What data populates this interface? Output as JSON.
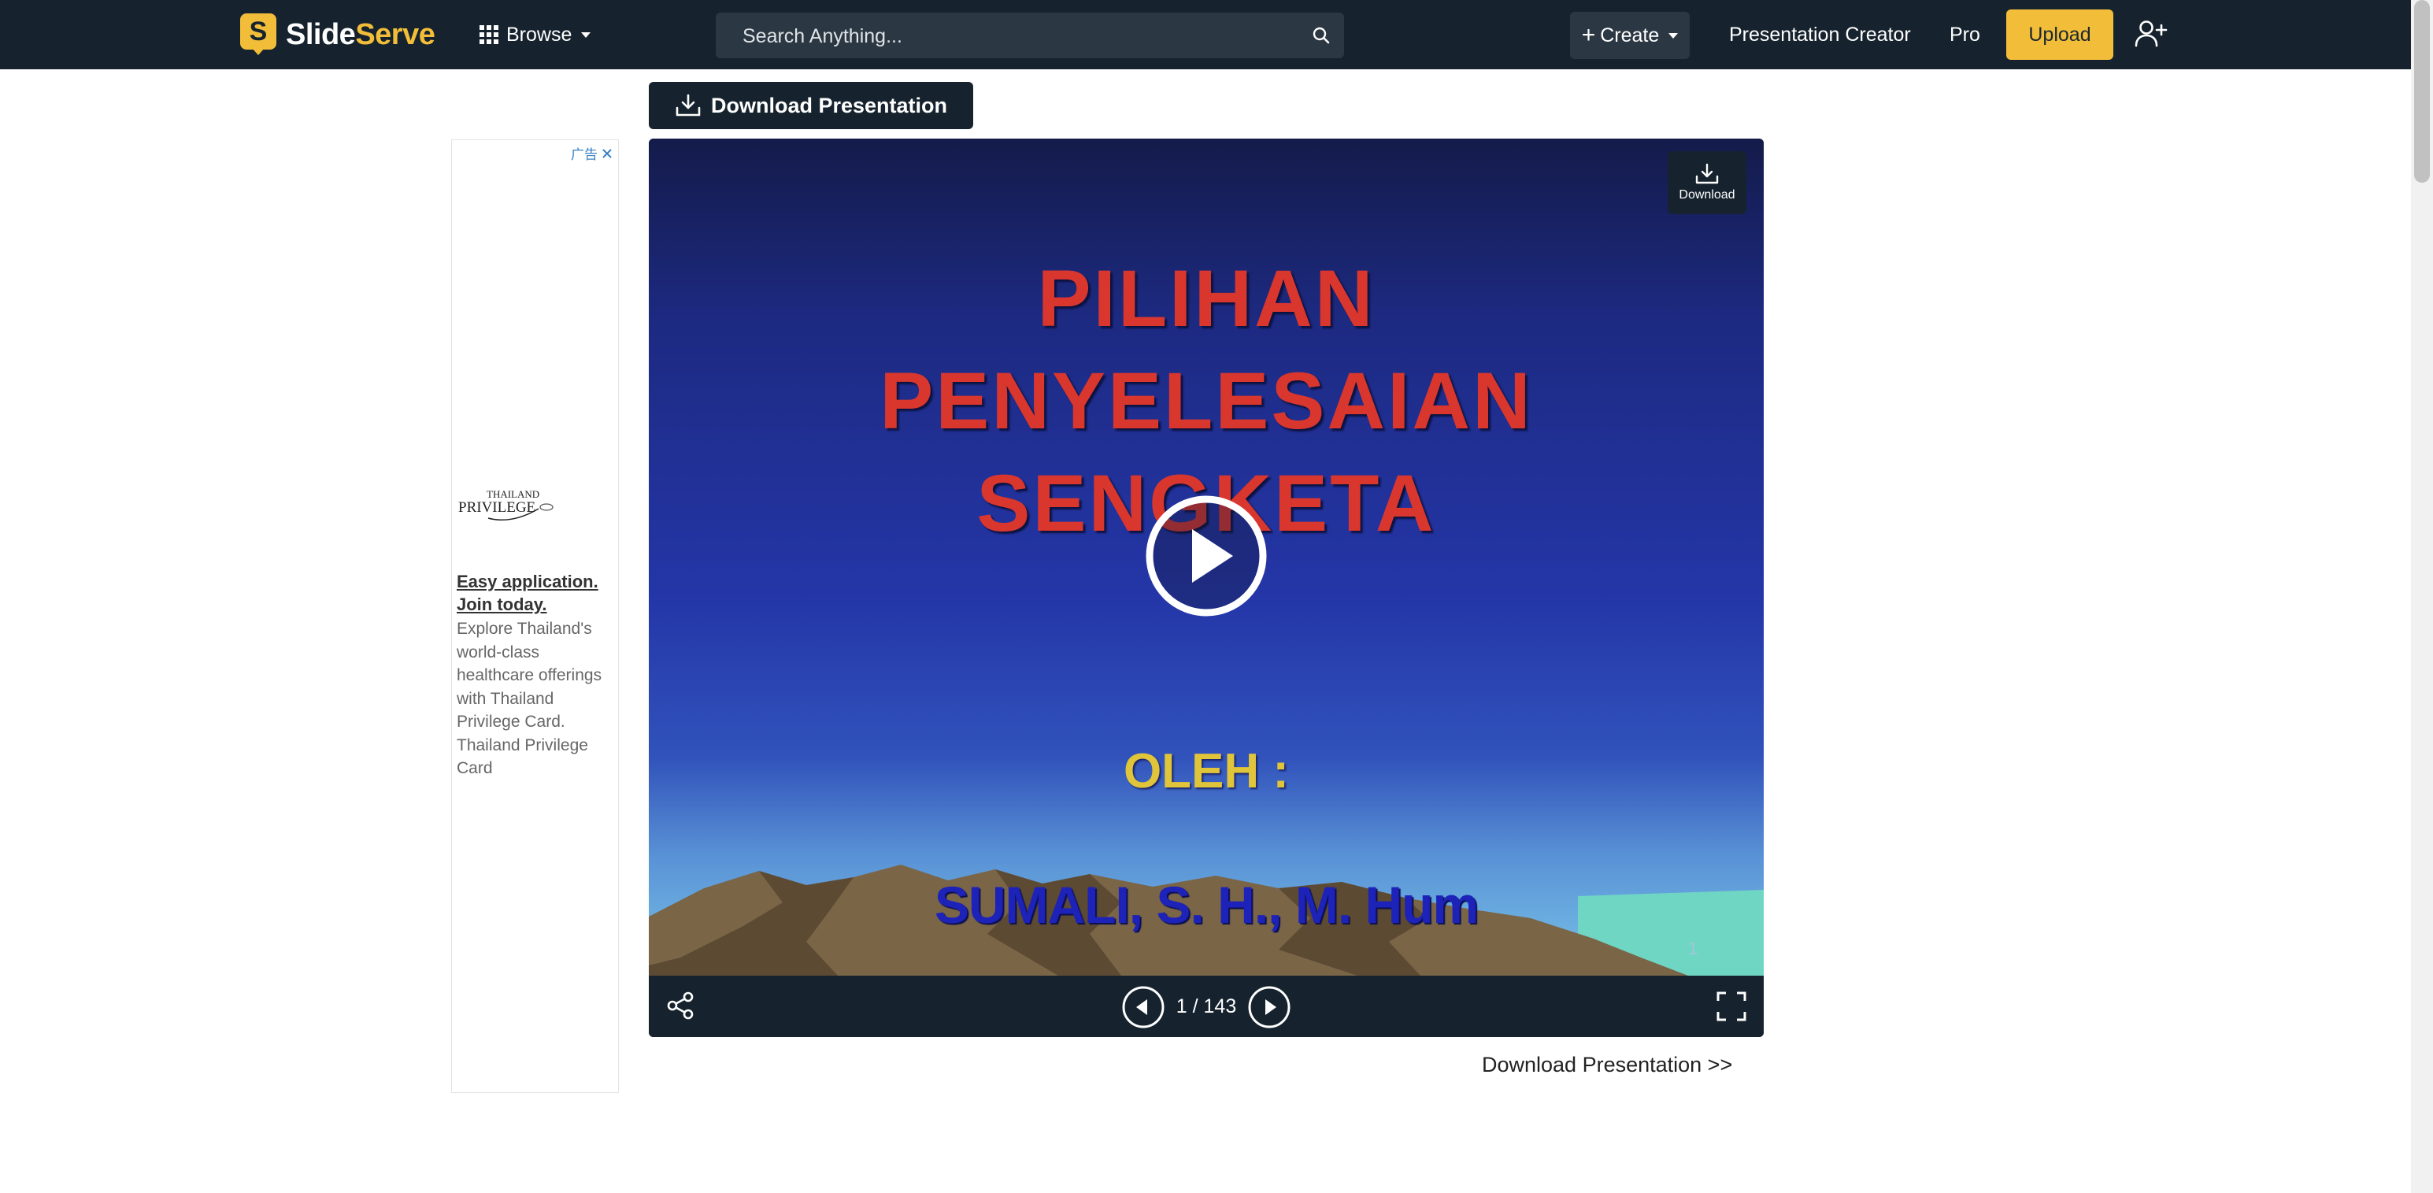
{
  "brand": {
    "name_part1": "Slide",
    "name_part2": "Serve",
    "mark_letter": "S"
  },
  "nav": {
    "browse_label": "Browse",
    "search_placeholder": "Search Anything...",
    "create_label": "Create",
    "presentation_creator_label": "Presentation Creator",
    "pro_label": "Pro",
    "upload_label": "Upload"
  },
  "toolbar": {
    "download_presentation_label": "Download Presentation"
  },
  "ad": {
    "badge_text": "广告",
    "logo_text_top": "THAILAND",
    "logo_text_bottom": "PRIVILEGE",
    "title": "Easy application. Join today.",
    "body": "Explore Thailand's world-class healthcare offerings with Thailand Privilege Card. Thailand Privilege Card"
  },
  "slide": {
    "title_line1": "PILIHAN",
    "title_line2": "PENYELESAIAN",
    "title_line3": "SENGKETA",
    "by_label": "OLEH :",
    "author": "SUMALI, S. H., M. Hum",
    "slide_number": "1",
    "corner_download_label": "Download"
  },
  "viewer": {
    "counter": "1 / 143"
  },
  "footer": {
    "download_link": "Download Presentation >>"
  },
  "colors": {
    "navbar": "#16232e",
    "accent": "#f2be39",
    "title_red": "#d9362e",
    "by_yellow": "#e0c43a",
    "author_blue": "#1d22b8"
  },
  "icons": [
    "grid-icon",
    "chevron-down-icon",
    "search-icon",
    "plus-icon",
    "user-plus-icon",
    "download-icon",
    "close-icon",
    "play-icon",
    "share-icon",
    "arrow-left-icon",
    "arrow-right-icon",
    "fullscreen-icon"
  ]
}
